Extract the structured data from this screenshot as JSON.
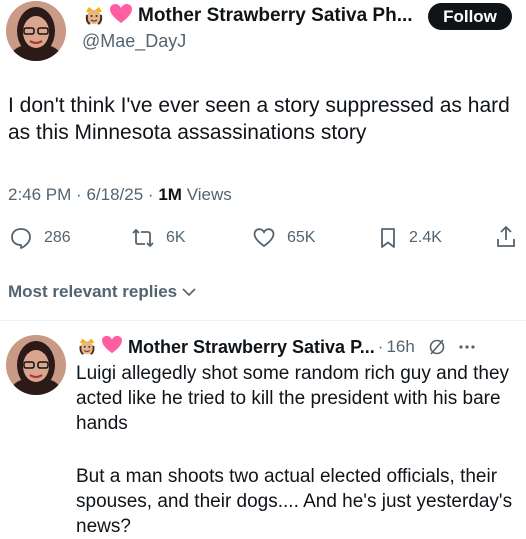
{
  "main_tweet": {
    "display_name": "Mother Strawberry Sativa Ph...",
    "handle": "@Mae_DayJ",
    "follow_label": "Follow",
    "text": "I don't think I've ever seen a story suppressed as hard as this Minnesota assassinations story",
    "time": "2:46 PM",
    "date": "6/18/25",
    "views_count": "1M",
    "views_label": "Views",
    "stats": {
      "replies": "286",
      "reposts": "6K",
      "likes": "65K",
      "bookmarks": "2.4K"
    }
  },
  "replies_sort": {
    "label": "Most relevant replies"
  },
  "reply": {
    "display_name": "Mother Strawberry Sativa P...",
    "age": "16h",
    "paragraph_1": "Luigi allegedly shot some random rich guy and they acted like he tried to kill the president with his bare hands",
    "paragraph_2": "But a man shoots two actual elected officials, their spouses, and their dogs.... And he's just yesterday's news?"
  },
  "colors": {
    "text_primary": "#0f1419",
    "text_secondary": "#536471",
    "heart_emoji": "#ff5fa2",
    "divider": "#eff3f4"
  },
  "icons": [
    "crown-emoji-icon",
    "pink-heart-icon",
    "reply-icon",
    "repost-icon",
    "like-icon",
    "bookmark-icon",
    "share-icon",
    "chevron-down-icon",
    "grok-slash-icon",
    "more-icon"
  ]
}
